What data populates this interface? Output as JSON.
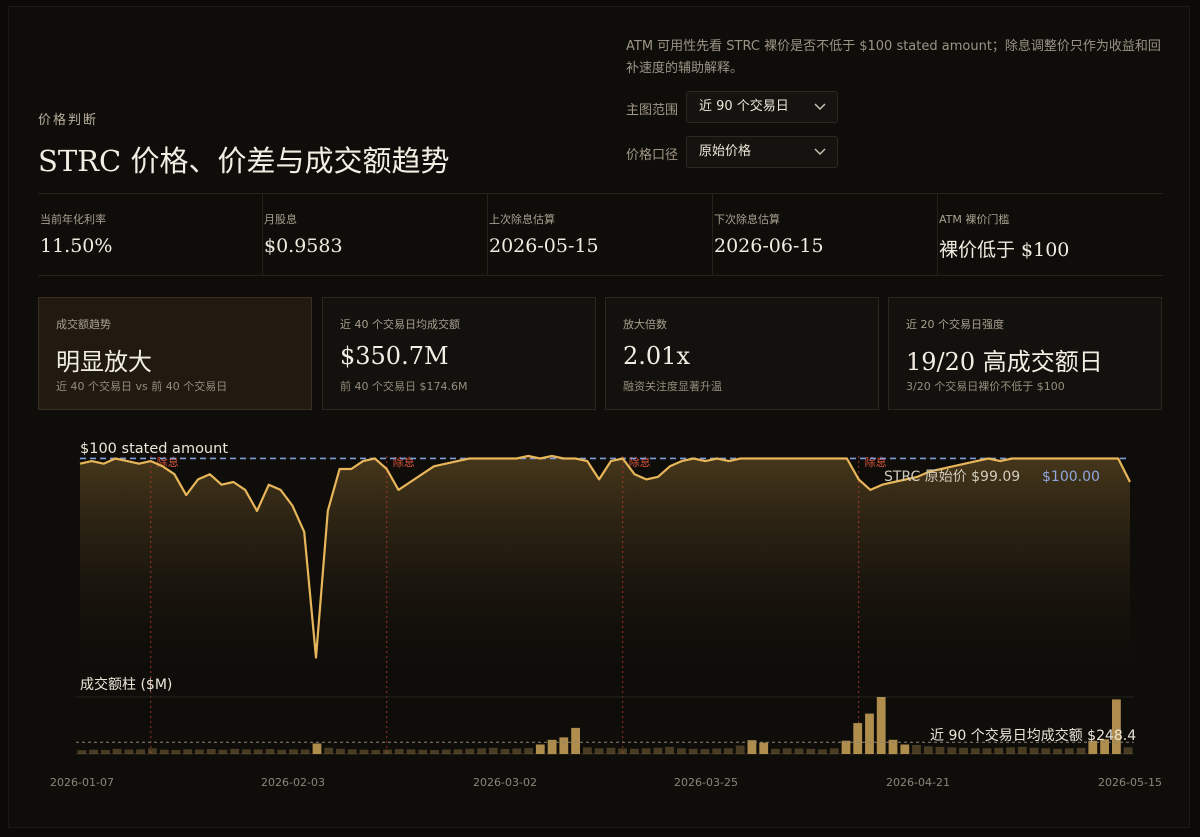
{
  "header": {
    "note": "ATM 可用性先看 STRC 裸价是否不低于 $100 stated amount；除息调整价只作为收益和回补速度的辅助解释。",
    "eyebrow": "价格判断",
    "title": "STRC 价格、价差与成交额趋势"
  },
  "controls": [
    {
      "label": "主图范围",
      "value": "近 90 个交易日"
    },
    {
      "label": "价格口径",
      "value": "原始价格"
    }
  ],
  "stats": [
    {
      "label": "当前年化利率",
      "value": "11.50%"
    },
    {
      "label": "月股息",
      "value": "$0.9583"
    },
    {
      "label": "上次除息估算",
      "value": "2026-05-15"
    },
    {
      "label": "下次除息估算",
      "value": "2026-06-15"
    },
    {
      "label": "ATM 裸价门槛",
      "value": "裸价低于 $100"
    }
  ],
  "cards": [
    {
      "label": "成交额趋势",
      "value": "明显放大",
      "sub": "近 40 个交易日 vs 前 40 个交易日"
    },
    {
      "label": "近 40 个交易日均成交额",
      "value": "$350.7M",
      "sub": "前 40 个交易日 $174.6M"
    },
    {
      "label": "放大倍数",
      "value": "2.01x",
      "sub": "融资关注度显著升温"
    },
    {
      "label": "近 20 个交易日强度",
      "value": "19/20 高成交额日",
      "sub": "3/20 个交易日裸价不低于 $100"
    }
  ],
  "colors": {
    "price_line": "#e8b65a",
    "reference_line": "#7f9bd8",
    "dividend_marker": "#c0392b",
    "volume_bar": "#b89550"
  },
  "chart_data": [
    {
      "type": "area",
      "series": [
        {
          "name": "STRC 原始价",
          "values": [
            99.9,
            99.95,
            99.9,
            100.0,
            99.95,
            99.9,
            99.95,
            99.85,
            99.7,
            99.3,
            99.6,
            99.7,
            99.5,
            99.55,
            99.4,
            99.0,
            99.5,
            99.4,
            99.1,
            98.6,
            96.2,
            99.0,
            99.8,
            99.8,
            99.95,
            100.0,
            99.8,
            99.4,
            99.55,
            99.7,
            99.85,
            99.9,
            99.95,
            100.0,
            100.0,
            100.0,
            100.0,
            100.0,
            100.05,
            100.0,
            100.05,
            100.0,
            100.0,
            99.95,
            99.6,
            99.95,
            100.0,
            99.7,
            99.6,
            99.65,
            99.85,
            99.95,
            100.0,
            99.95,
            100.0,
            99.95,
            100.0,
            100.0,
            100.0,
            100.0,
            100.0,
            100.0,
            100.0,
            100.0,
            100.0,
            100.0,
            99.6,
            99.4,
            99.5,
            99.55,
            99.6,
            99.65,
            99.75,
            99.8,
            99.85,
            99.9,
            99.95,
            100.0,
            99.95,
            100.0,
            100.0,
            100.0,
            100.0,
            100.0,
            100.0,
            100.0,
            100.0,
            100.0,
            100.0,
            99.55
          ]
        }
      ],
      "reference_line": {
        "value": 100,
        "label": "$100 stated amount"
      },
      "dividend_marker_label": "除息",
      "ex_dividend_indices": [
        6,
        26,
        46,
        66
      ],
      "end_labels": {
        "series_value": "$99.09",
        "reference_value": "$100.00"
      },
      "ylim": [
        96.0,
        100.2
      ],
      "grid": false
    },
    {
      "type": "bar",
      "title": "成交额柱 ($M)",
      "series": [
        {
          "name": "成交额",
          "values": [
            80,
            90,
            85,
            110,
            95,
            100,
            120,
            90,
            85,
            100,
            95,
            105,
            90,
            110,
            100,
            95,
            105,
            90,
            100,
            95,
            220,
            130,
            110,
            100,
            90,
            85,
            95,
            105,
            100,
            90,
            85,
            95,
            100,
            110,
            120,
            130,
            105,
            115,
            125,
            200,
            300,
            350,
            550,
            140,
            120,
            130,
            115,
            110,
            120,
            130,
            150,
            120,
            110,
            105,
            115,
            120,
            180,
            290,
            240,
            110,
            120,
            115,
            110,
            100,
            120,
            280,
            650,
            850,
            1200,
            300,
            200,
            190,
            160,
            150,
            140,
            130,
            120,
            120,
            130,
            140,
            150,
            130,
            120,
            110,
            120,
            130,
            280,
            310,
            1150,
            140
          ]
        }
      ],
      "average_line": {
        "value": 248.4,
        "label": "近 90 个交易日均成交额 $248.4"
      },
      "ylim": [
        0,
        1200
      ],
      "x_tick_labels": [
        "2026-01-07",
        "2026-02-03",
        "2026-03-02",
        "2026-03-25",
        "2026-04-21",
        "2026-05-15"
      ]
    }
  ]
}
